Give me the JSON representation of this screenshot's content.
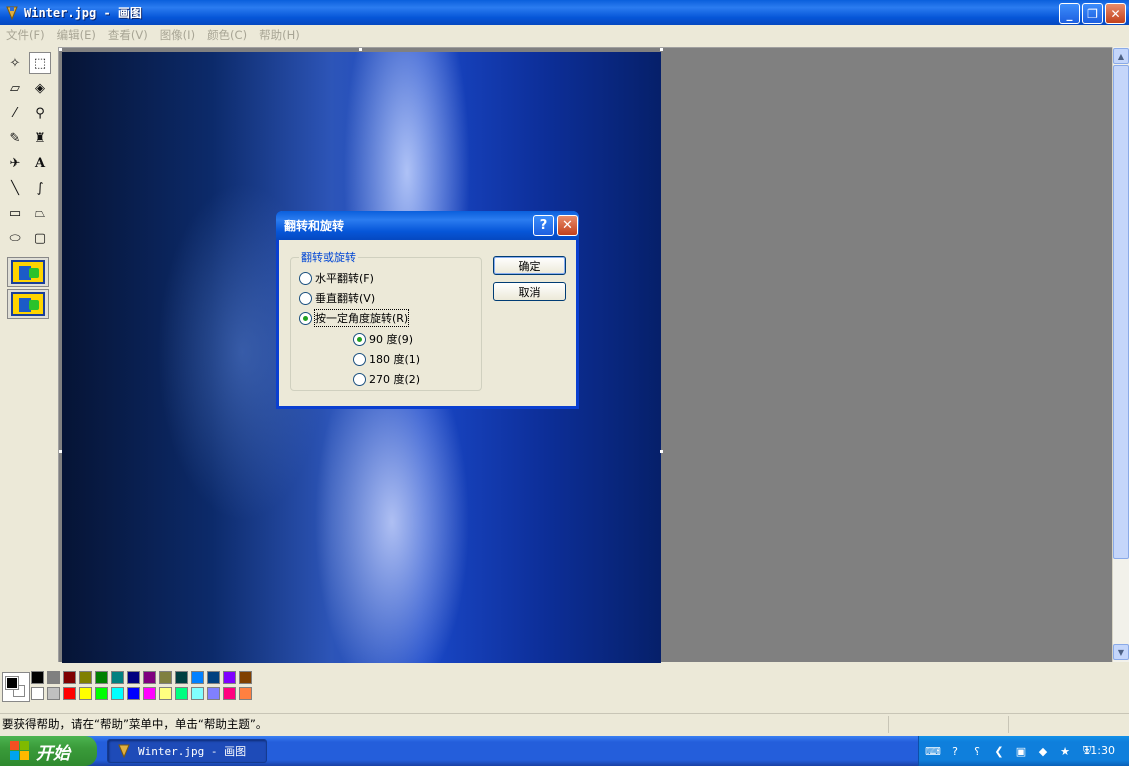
{
  "window": {
    "title": "Winter.jpg - 画图"
  },
  "menu": [
    "文件(F)",
    "编辑(E)",
    "查看(V)",
    "图像(I)",
    "颜色(C)",
    "帮助(H)"
  ],
  "palette_colors": [
    "#000000",
    "#808080",
    "#800000",
    "#808000",
    "#008000",
    "#008080",
    "#000080",
    "#800080",
    "#808040",
    "#004040",
    "#0080ff",
    "#004080",
    "#8000ff",
    "#804000",
    "#ffffff",
    "#c0c0c0",
    "#ff0000",
    "#ffff00",
    "#00ff00",
    "#00ffff",
    "#0000ff",
    "#ff00ff",
    "#ffff80",
    "#00ff80",
    "#80ffff",
    "#8080ff",
    "#ff0080",
    "#ff8040"
  ],
  "status": {
    "help_text": "要获得帮助，请在“帮助”菜单中，单击“帮助主题”。"
  },
  "dialog": {
    "title": "翻转和旋转",
    "group_label": "翻转或旋转",
    "options": [
      "水平翻转(F)",
      "垂直翻转(V)",
      "按一定角度旋转(R)"
    ],
    "angles": [
      "90 度(9)",
      "180 度(1)",
      "270 度(2)"
    ],
    "ok": "确定",
    "cancel": "取消",
    "selected_option": "按一定角度旋转(R)",
    "selected_angle": "90 度(9)"
  },
  "taskbar": {
    "start": "开始",
    "task": "Winter.jpg - 画图",
    "clock": "11:30"
  }
}
